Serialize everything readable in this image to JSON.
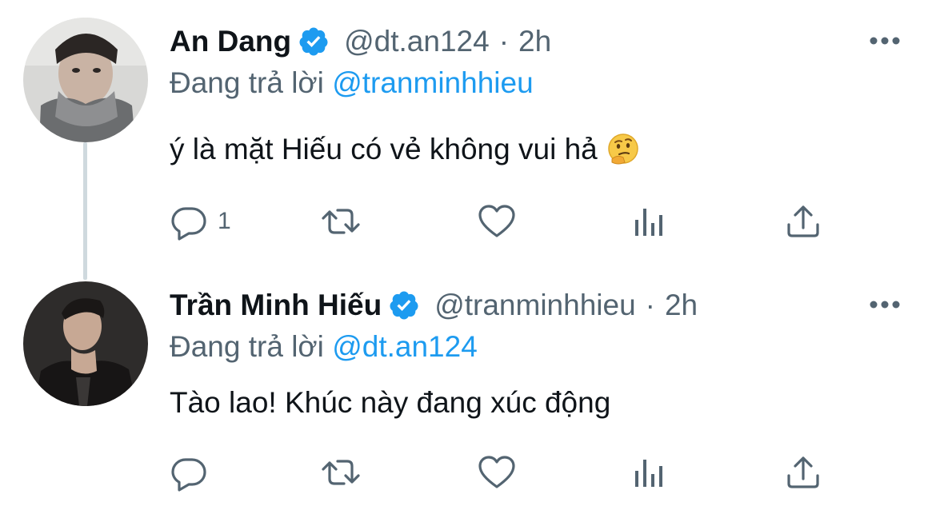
{
  "tweets": [
    {
      "name": "An Dang",
      "handle": "@dt.an124",
      "separator": "·",
      "time": "2h",
      "reply_prefix": "Đang trả lời",
      "reply_to": "@tranminhhieu",
      "text": "ý là mặt Hiếu có vẻ không vui hả",
      "emoji": "thinking-face",
      "reply_count": "1"
    },
    {
      "name": "Trần Minh Hiếu",
      "handle": "@tranminhhieu",
      "separator": "·",
      "time": "2h",
      "reply_prefix": "Đang trả lời",
      "reply_to": "@dt.an124",
      "text": "Tào lao! Khúc này đang xúc động",
      "reply_count": ""
    }
  ],
  "icons": {
    "verified": "verified-badge-icon",
    "more": "more-options-icon",
    "reply": "reply-icon",
    "retweet": "retweet-icon",
    "like": "like-icon",
    "analytics": "analytics-icon",
    "share": "share-icon"
  },
  "colors": {
    "accent": "#1d9bf0",
    "secondary_text": "#536471",
    "primary_text": "#0f1419",
    "thread_line": "#cfd9de"
  }
}
